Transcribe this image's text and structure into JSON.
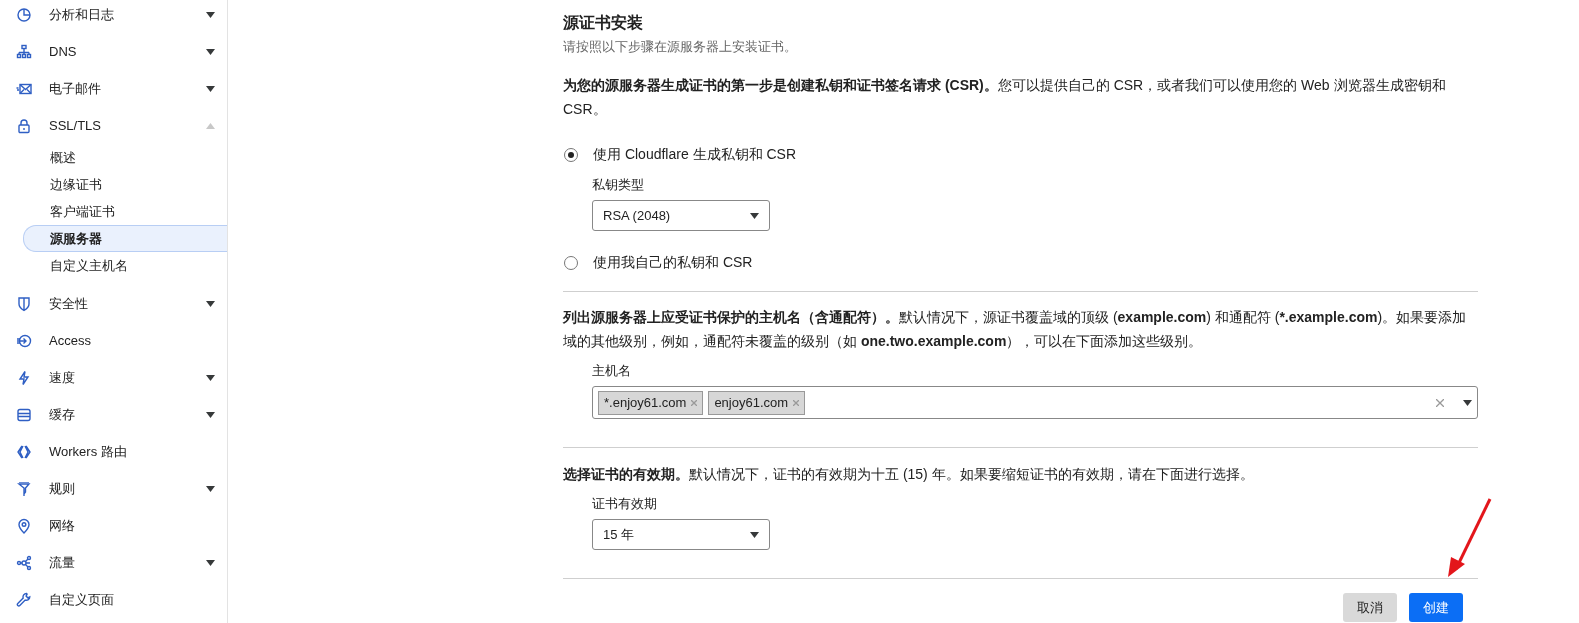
{
  "sidebar": {
    "items": [
      {
        "label": "分析和日志",
        "kind": "group",
        "expanded": false
      },
      {
        "label": "DNS",
        "kind": "group",
        "expanded": false
      },
      {
        "label": "电子邮件",
        "kind": "group",
        "expanded": false
      },
      {
        "label": "SSL/TLS",
        "kind": "group",
        "expanded": true,
        "children": [
          {
            "label": "概述",
            "selected": false
          },
          {
            "label": "边缘证书",
            "selected": false
          },
          {
            "label": "客户端证书",
            "selected": false
          },
          {
            "label": "源服务器",
            "selected": true
          },
          {
            "label": "自定义主机名",
            "selected": false
          }
        ]
      },
      {
        "label": "安全性",
        "kind": "group",
        "expanded": false
      },
      {
        "label": "Access",
        "kind": "link"
      },
      {
        "label": "速度",
        "kind": "group",
        "expanded": false
      },
      {
        "label": "缓存",
        "kind": "group",
        "expanded": false
      },
      {
        "label": "Workers 路由",
        "kind": "link"
      },
      {
        "label": "规则",
        "kind": "group",
        "expanded": false
      },
      {
        "label": "网络",
        "kind": "link"
      },
      {
        "label": "流量",
        "kind": "group",
        "expanded": false
      },
      {
        "label": "自定义页面",
        "kind": "link"
      }
    ]
  },
  "main": {
    "title": "源证书安装",
    "subtitle": "请按照以下步骤在源服务器上安装证书。",
    "sections": [
      {
        "text": "**为您的源服务器生成证书的第一步是创建私钥和证书签名请求 (CSR)。**您可以提供自己的 CSR，或者我们可以使用您的 Web 浏览器生成密钥和 CSR。",
        "options": [
          {
            "label": "使用 Cloudflare 生成私钥和 CSR",
            "selected": true,
            "field": {
              "label": "私钥类型",
              "value": "RSA (2048)"
            }
          },
          {
            "label": "使用我自己的私钥和 CSR",
            "selected": false
          }
        ]
      },
      {
        "text": "**列出源服务器上应受证书保护的主机名（含通配符）。**默认情况下，源证书覆盖域的顶级 (**example.com**) 和通配符 (***.example.com**)。如果要添加域的其他级别，例如，通配符未覆盖的级别（如 **one.two.example.com**），可以在下面添加这些级别。",
        "tags_field": {
          "label": "主机名",
          "tags": [
            "*.enjoy61.com",
            "enjoy61.com"
          ]
        }
      },
      {
        "text": "**选择证书的有效期。**默认情况下，证书的有效期为十五 (15) 年。如果要缩短证书的有效期，请在下面进行选择。",
        "select": {
          "label": "证书有效期",
          "value": "15 年"
        }
      }
    ],
    "buttons": [
      {
        "label": "取消",
        "kind": "secondary"
      },
      {
        "label": "创建",
        "kind": "primary"
      }
    ]
  }
}
